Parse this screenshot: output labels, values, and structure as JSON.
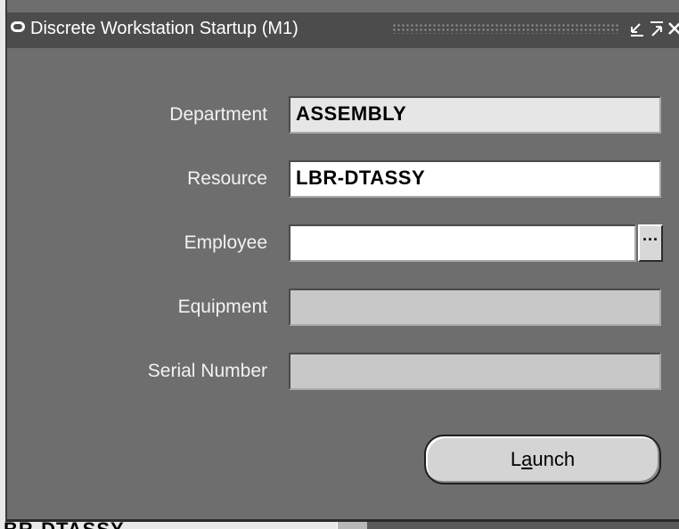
{
  "window": {
    "title": "Discrete Workstation Startup (M1)",
    "controls": {
      "minimize_icon": "minimize-icon",
      "maximize_icon": "maximize-icon",
      "close_icon": "close-icon"
    }
  },
  "form": {
    "department": {
      "label": "Department",
      "value": "ASSEMBLY"
    },
    "resource": {
      "label": "Resource",
      "value": "LBR-DTASSY"
    },
    "employee": {
      "label": "Employee",
      "value": "",
      "lov_label": "···"
    },
    "equipment": {
      "label": "Equipment",
      "value": ""
    },
    "serial_number": {
      "label": "Serial Number",
      "value": ""
    }
  },
  "actions": {
    "launch_prefix": "L",
    "launch_mnemonic": "a",
    "launch_suffix": "unch"
  },
  "background": {
    "peek_text": "BR-DTASSY"
  },
  "colors": {
    "window_bg": "#6e6e6e",
    "titlebar_bg": "#4c4c4c",
    "label_text": "#f2f2f2"
  }
}
